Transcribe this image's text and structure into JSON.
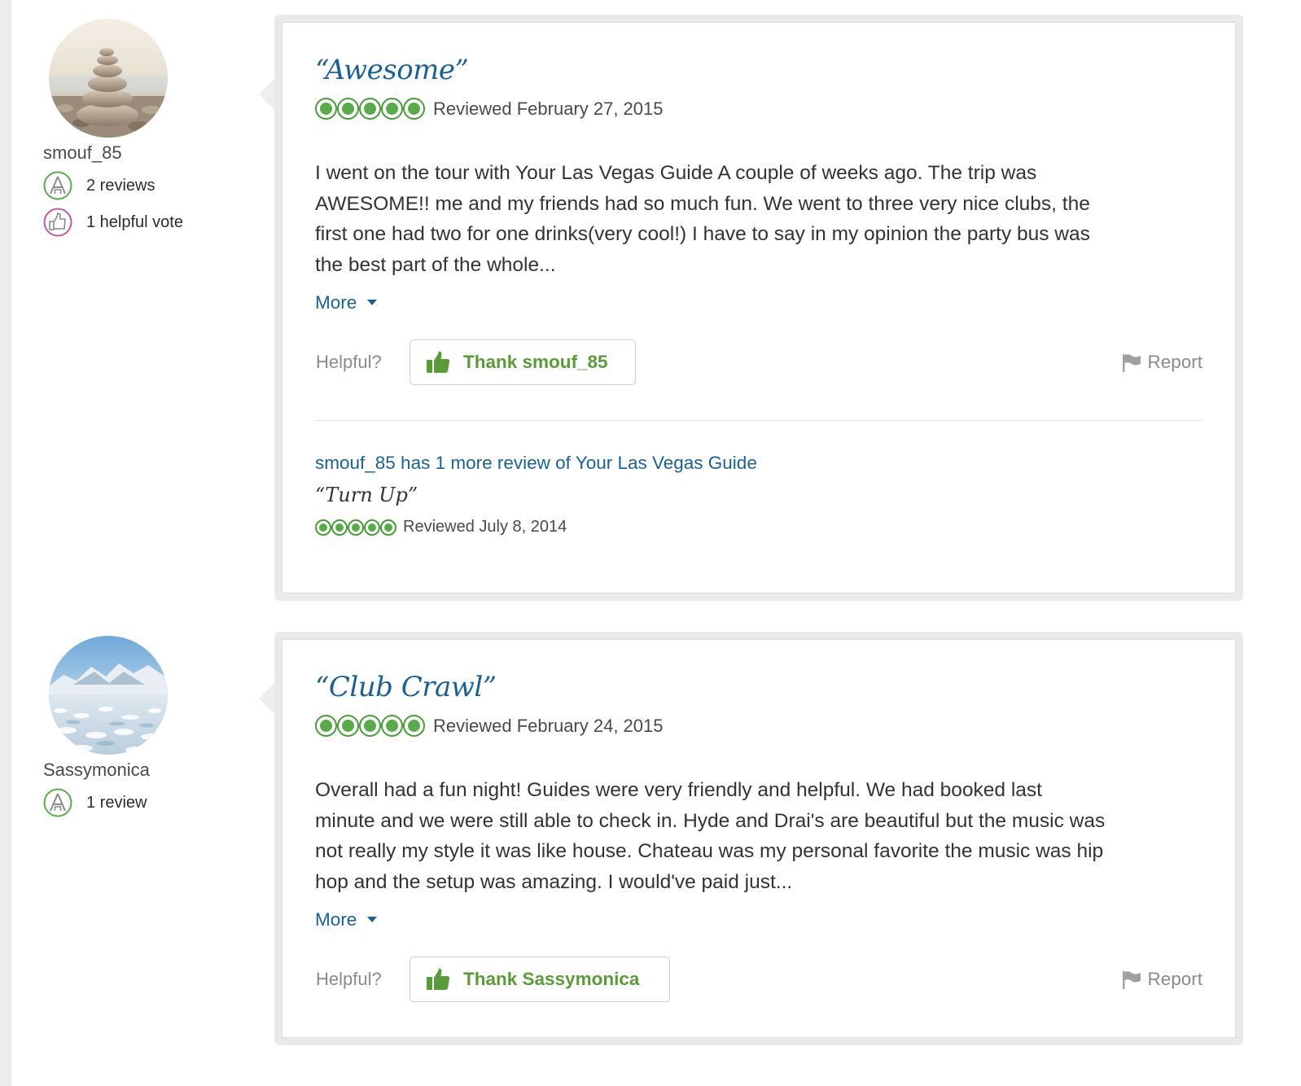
{
  "reviews": [
    {
      "member": {
        "username": "smouf_85",
        "badges": [
          {
            "icon": "reviewer-badge-icon",
            "text": "2 reviews"
          },
          {
            "icon": "helpful-vote-badge-icon",
            "text": "1 helpful vote"
          }
        ]
      },
      "title": "“Awesome”",
      "rating_bubbles": 5,
      "date": "Reviewed February 27, 2015",
      "body_lines": [
        "I went on the tour with Your Las Vegas Guide A couple of weeks ago. The trip was",
        "AWESOME!! me and my friends had so much fun. We went to three very nice clubs, the",
        "first one had two for one drinks(very cool!) I have to say in my opinion the party bus was",
        "the best part of the whole..."
      ],
      "more_label": "More",
      "helpful_label": "Helpful?",
      "thank_label": "Thank smouf_85",
      "report_label": "Report",
      "other_review": {
        "link_text": "smouf_85 has 1 more review of Your Las Vegas Guide",
        "title": "“Turn Up”",
        "rating_bubbles": 5,
        "date": "Reviewed July 8, 2014"
      }
    },
    {
      "member": {
        "username": "Sassymonica",
        "badges": [
          {
            "icon": "reviewer-badge-icon",
            "text": "1 review"
          }
        ]
      },
      "title": "“Club Crawl”",
      "rating_bubbles": 5,
      "date": "Reviewed February 24, 2015",
      "body_lines": [
        "Overall had a fun night! Guides were very friendly and helpful. We had booked last",
        "minute and we were still able to check in. Hyde and Drai's are beautiful but the music was",
        "not really my style it was like house. Chateau was my personal favorite the music was hip",
        "hop and the setup was amazing. I would've paid just..."
      ],
      "more_label": "More",
      "helpful_label": "Helpful?",
      "thank_label": "Thank Sassymonica",
      "report_label": "Report"
    }
  ],
  "colors": {
    "link_blue": "#1e6091",
    "bubble_green": "#5aa94a",
    "thank_green": "#5a9a3a",
    "reviewer_badge": "#5aa94a",
    "helpful_badge": "#c0589a"
  }
}
